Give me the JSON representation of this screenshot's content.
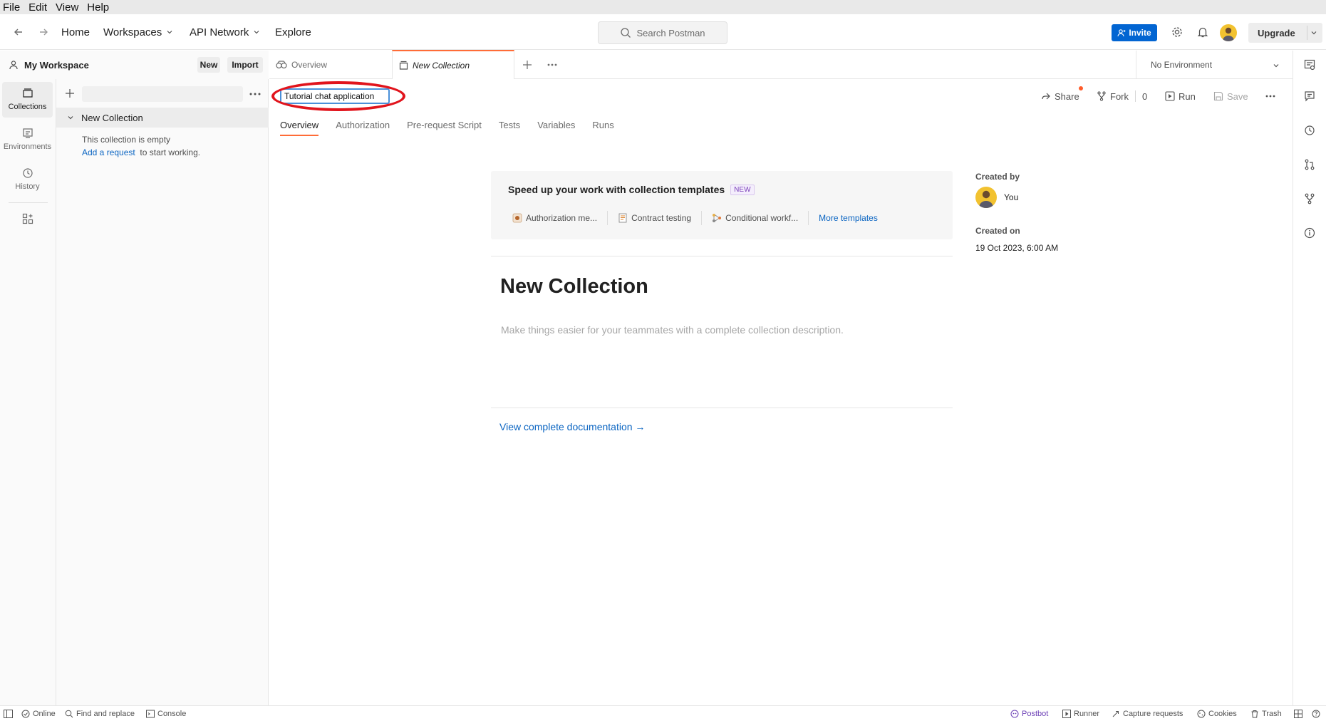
{
  "menubar": {
    "items": [
      "File",
      "Edit",
      "View",
      "Help"
    ]
  },
  "header": {
    "home": "Home",
    "workspaces": "Workspaces",
    "api_network": "API Network",
    "explore": "Explore",
    "search_placeholder": "Search Postman",
    "invite": "Invite",
    "upgrade": "Upgrade"
  },
  "leftnav": {
    "collections": "Collections",
    "environments": "Environments",
    "history": "History"
  },
  "sidebar": {
    "workspace_name": "My Workspace",
    "new_btn": "New",
    "import_btn": "Import",
    "collection_name": "New Collection",
    "empty_text": "This collection is empty",
    "add_request": "Add a request",
    "to_start": "to start working."
  },
  "tabs": [
    {
      "label": "Overview"
    },
    {
      "label": "New Collection"
    }
  ],
  "environment": "No Environment",
  "collection": {
    "name_input_value": "Tutorial chat application",
    "share": "Share",
    "fork": "Fork",
    "fork_count": "0",
    "run": "Run",
    "save": "Save",
    "subtabs": [
      "Overview",
      "Authorization",
      "Pre-request Script",
      "Tests",
      "Variables",
      "Runs"
    ],
    "title": "New Collection",
    "description_placeholder": "Make things easier for your teammates with a complete collection description.",
    "view_docs": "View complete documentation →"
  },
  "templates": {
    "heading": "Speed up your work with collection templates",
    "badge": "NEW",
    "items": [
      "Authorization me...",
      "Contract testing",
      "Conditional workf..."
    ],
    "more": "More templates"
  },
  "meta": {
    "created_by_label": "Created by",
    "created_by": "You",
    "created_on_label": "Created on",
    "created_on": "19 Oct 2023, 6:00 AM"
  },
  "statusbar": {
    "online": "Online",
    "find_replace": "Find and replace",
    "console": "Console",
    "postbot": "Postbot",
    "runner": "Runner",
    "capture": "Capture requests",
    "cookies": "Cookies",
    "trash": "Trash"
  },
  "colors": {
    "accent": "#ff6c37",
    "primary_blue": "#0265d2",
    "link": "#0b65c2",
    "highlight_ring": "#e1141c"
  }
}
